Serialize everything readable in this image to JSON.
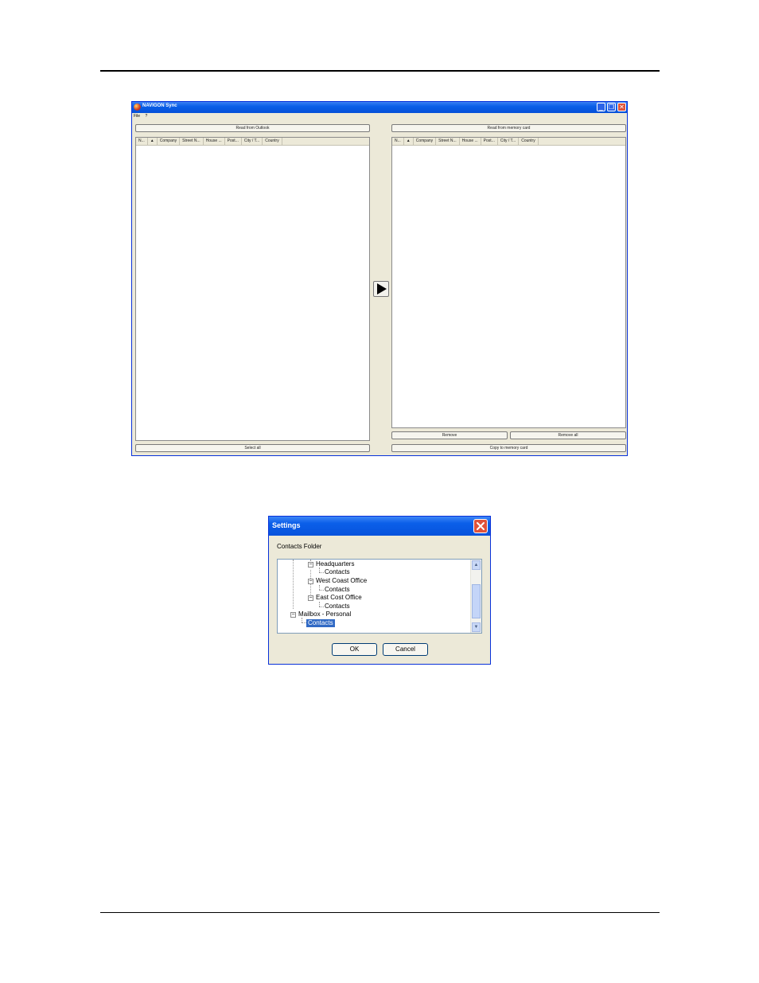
{
  "main_window": {
    "title": "NAVIGON Sync",
    "menu": [
      "File",
      "?"
    ],
    "left_panel": {
      "read_button": "Read from Outlook",
      "columns": [
        "N...",
        "▲",
        "Company",
        "Street N...",
        "House ...",
        "Post...",
        "City / T...",
        "Country"
      ],
      "select_all_button": "Select all"
    },
    "right_panel": {
      "read_button": "Read from memory card",
      "columns": [
        "N...",
        "▲",
        "Company",
        "Street N...",
        "House ...",
        "Post...",
        "City / T...",
        "Country"
      ],
      "remove_button": "Remove",
      "remove_all_button": "Remove all",
      "copy_button": "Copy to memory card"
    },
    "transfer_icon": "play-arrow-icon"
  },
  "settings_dialog": {
    "title": "Settings",
    "label": "Contacts Folder",
    "tree": [
      {
        "label": "Headquarters",
        "expander": "−"
      },
      {
        "label": "Contacts"
      },
      {
        "label": "West Coast Office",
        "expander": "−"
      },
      {
        "label": "Contacts"
      },
      {
        "label": "East Cost Office",
        "expander": "−"
      },
      {
        "label": "Contacts"
      },
      {
        "label": "Mailbox - Personal",
        "expander": "−"
      },
      {
        "label": "Contacts",
        "selected": true
      }
    ],
    "ok_button": "OK",
    "cancel_button": "Cancel"
  }
}
